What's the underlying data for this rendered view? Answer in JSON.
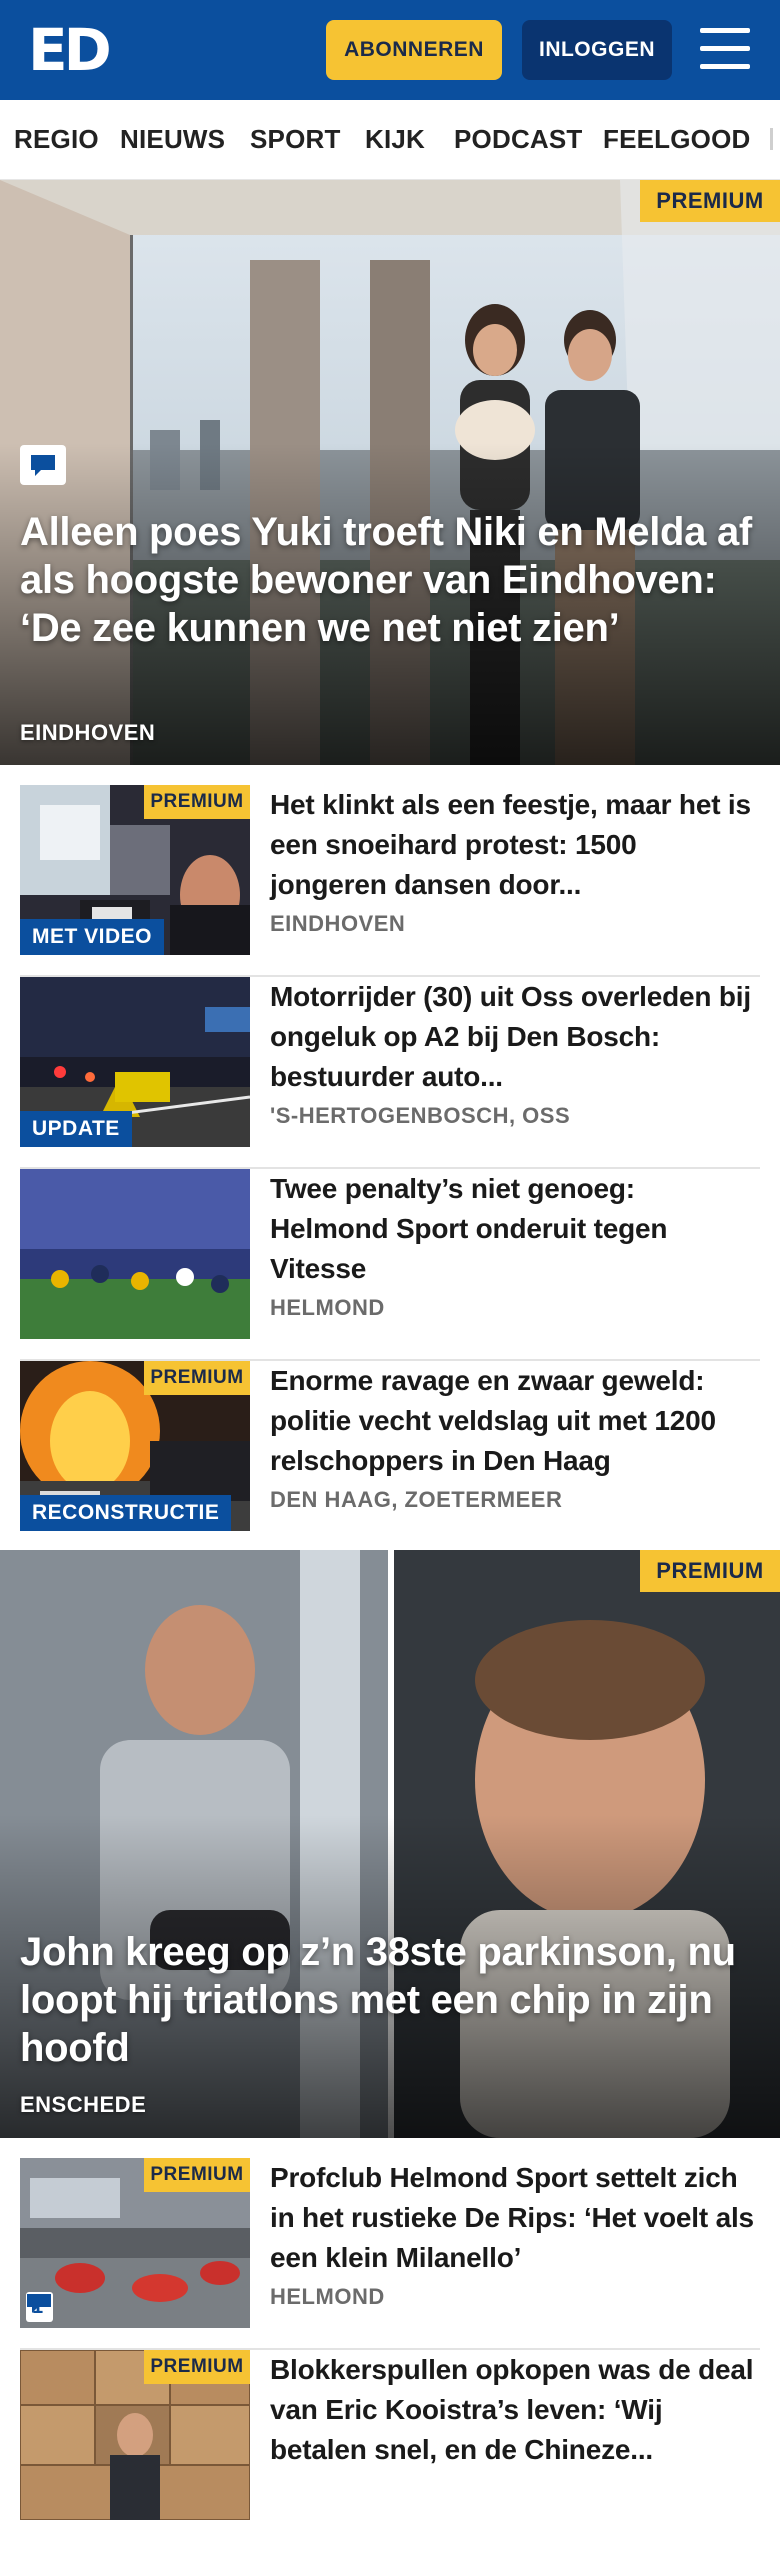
{
  "header": {
    "logo": "ED",
    "subscribe_label": "ABONNEREN",
    "login_label": "INLOGGEN",
    "menu_icon": "hamburger-menu-icon",
    "brand_color": "#0b4f9e",
    "accent_color": "#f6c333"
  },
  "nav": {
    "items": [
      "REGIO",
      "NIEUWS",
      "SPORT",
      "KIJK",
      "PODCAST",
      "FEELGOOD"
    ]
  },
  "hero": {
    "premium": "PREMIUM",
    "comment_icon": "comment-icon",
    "title": "Alleen poes Yuki troeft Niki en Melda af als hoogste bewoner van Eindhoven: ‘De zee kunnen we net niet zien’",
    "location": "EINDHOVEN"
  },
  "articles": [
    {
      "premium": "PREMIUM",
      "label": "MET VIDEO",
      "title": "Het klinkt als een feestje, maar het is een snoeihard protest: 1500 jongeren dansen door...",
      "location": "EINDHOVEN"
    },
    {
      "label": "UPDATE",
      "title": "Motorrijder (30) uit Oss overleden bij ongeluk op A2 bij Den Bosch: bestuurder auto...",
      "location": "'S-HERTOGENBOSCH, OSS"
    },
    {
      "title": "Twee penalty’s niet genoeg: Helmond Sport onderuit tegen Vitesse",
      "location": "HELMOND"
    },
    {
      "premium": "PREMIUM",
      "label": "RECONSTRUCTIE",
      "title": "Enorme ravage en zwaar geweld: politie vecht veldslag uit met 1200 relschoppers in Den Haag",
      "location": "DEN HAAG, ZOETERMEER"
    }
  ],
  "feature": {
    "premium": "PREMIUM",
    "title": "John kreeg op z’n 38ste parkinson, nu loopt hij triatlons met een chip in zijn hoofd",
    "location": "ENSCHEDE"
  },
  "articles2": [
    {
      "premium": "PREMIUM",
      "comments": "1",
      "title": "Profclub Helmond Sport settelt zich in het rustieke De Rips: ‘Het voelt als een klein Milanello’",
      "location": "HELMOND"
    },
    {
      "premium": "PREMIUM",
      "title": "Blokkerspullen opkopen was de deal van Eric Kooistra’s leven: ‘Wij betalen snel, en de Chineze..."
    }
  ]
}
